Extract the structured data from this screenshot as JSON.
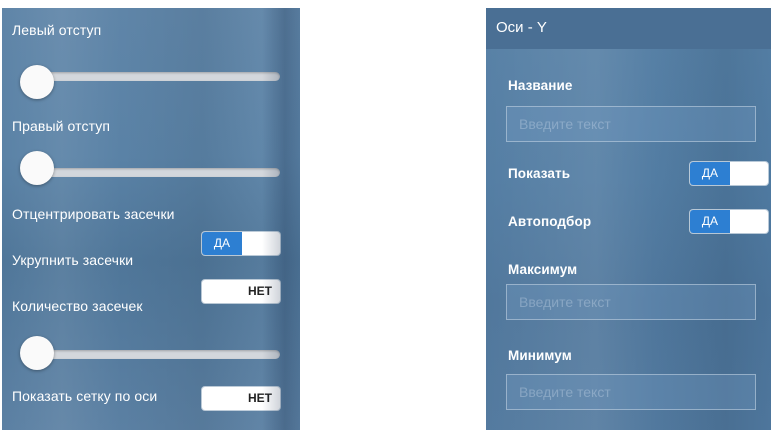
{
  "left_panel": {
    "left_indent": {
      "label": "Левый отступ",
      "value": 0
    },
    "right_indent": {
      "label": "Правый отступ",
      "value": 0
    },
    "center_ticks": {
      "label": "Отцентрировать засечки"
    },
    "enlarge_ticks": {
      "label": "Укрупнить засечки",
      "toggle": "ДА"
    },
    "tick_count": {
      "label": "Количество засечек",
      "toggle": "НЕТ",
      "value": 0
    },
    "show_axis_grid": {
      "label": "Показать сетку по оси",
      "toggle": "НЕТ"
    }
  },
  "right_panel": {
    "title": "Оси - Y",
    "name": {
      "label": "Название",
      "placeholder": "Введите текст"
    },
    "show": {
      "label": "Показать",
      "toggle": "ДА"
    },
    "auto_fit": {
      "label": "Автоподбор",
      "toggle": "ДА"
    },
    "maximum": {
      "label": "Максимум",
      "placeholder": "Введите текст"
    },
    "minimum": {
      "label": "Минимум",
      "placeholder": "Введите текст"
    }
  },
  "colors": {
    "panel_background": "#5a82a6",
    "header_background": "#4a6f94",
    "toggle_on": "#2d7fd2",
    "toggle_off_background": "#ffffff"
  }
}
